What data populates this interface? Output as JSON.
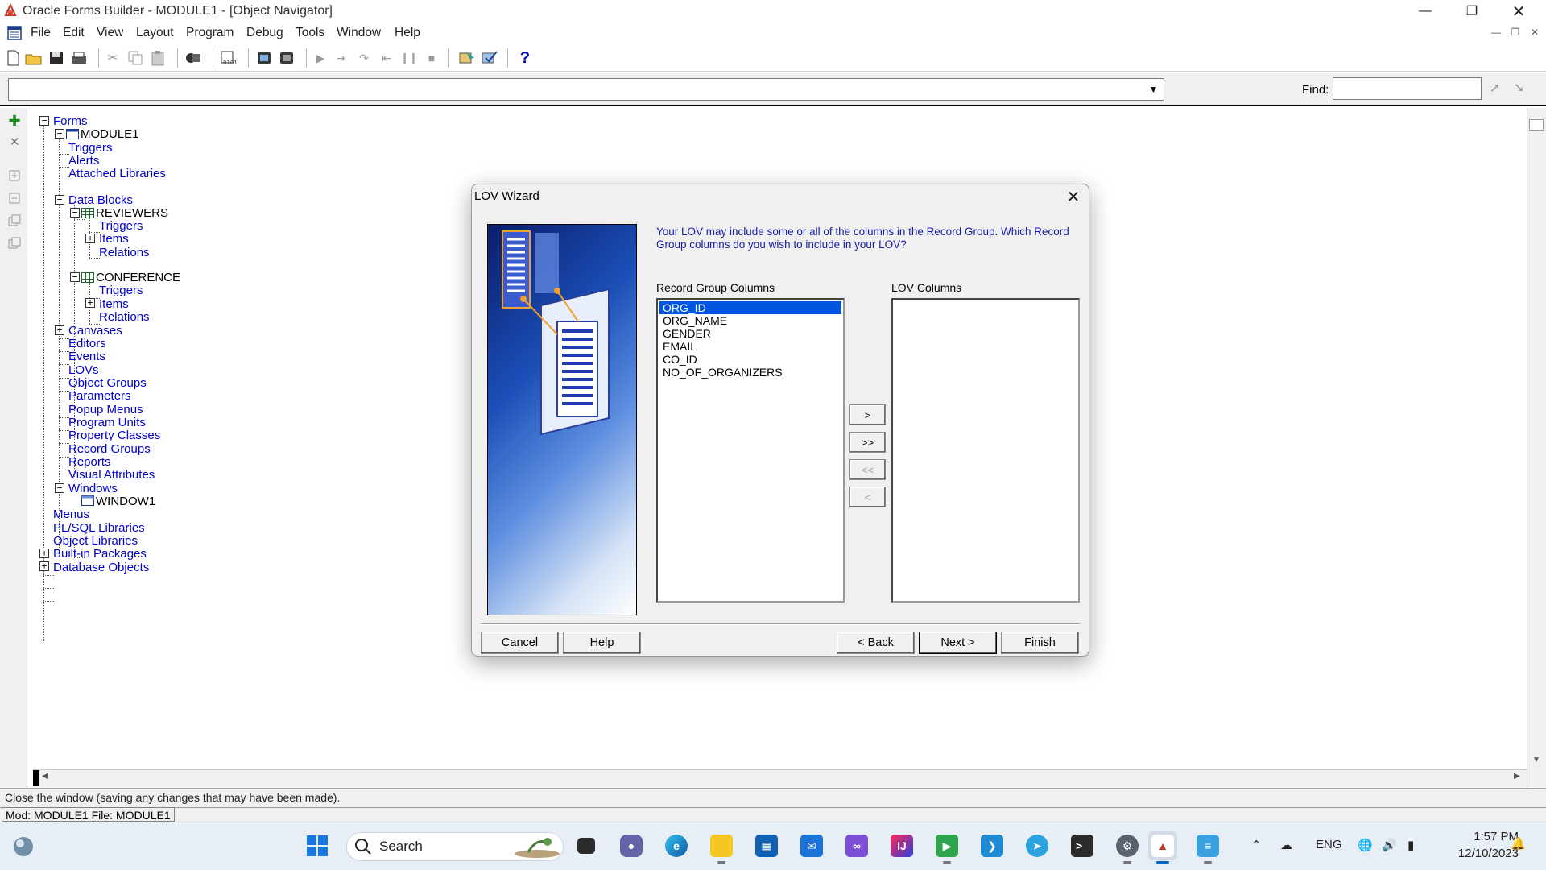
{
  "window": {
    "title": "Oracle Forms Builder - MODULE1 - [Object Navigator]",
    "minimize_icon": "minimize-icon",
    "restore_icon": "restore-icon",
    "close_icon": "close-icon"
  },
  "menu": {
    "items": [
      "File",
      "Edit",
      "View",
      "Layout",
      "Program",
      "Debug",
      "Tools",
      "Window",
      "Help"
    ]
  },
  "context_bar": {
    "combo_value": "",
    "find_label": "Find:",
    "find_value": ""
  },
  "navigator": {
    "nodes": [
      {
        "label": "Forms",
        "toggle": "minus"
      },
      {
        "label": "MODULE1",
        "toggle": "minus"
      },
      {
        "label": "Triggers"
      },
      {
        "label": "Alerts"
      },
      {
        "label": "Attached Libraries"
      },
      {
        "label": "Data Blocks",
        "toggle": "minus"
      },
      {
        "label": "REVIEWERS",
        "toggle": "minus"
      },
      {
        "label": "Triggers"
      },
      {
        "label": "Items",
        "toggle": "plus"
      },
      {
        "label": "Relations"
      },
      {
        "label": "CONFERENCE",
        "toggle": "minus"
      },
      {
        "label": "Triggers"
      },
      {
        "label": "Items",
        "toggle": "plus"
      },
      {
        "label": "Relations"
      },
      {
        "label": "Canvases",
        "toggle": "plus"
      },
      {
        "label": "Editors"
      },
      {
        "label": "Events"
      },
      {
        "label": "LOVs"
      },
      {
        "label": "Object Groups"
      },
      {
        "label": "Parameters"
      },
      {
        "label": "Popup Menus"
      },
      {
        "label": "Program Units"
      },
      {
        "label": "Property Classes"
      },
      {
        "label": "Record Groups"
      },
      {
        "label": "Reports"
      },
      {
        "label": "Visual Attributes"
      },
      {
        "label": "Windows",
        "toggle": "minus"
      },
      {
        "label": "WINDOW1"
      },
      {
        "label": "Menus"
      },
      {
        "label": "PL/SQL Libraries"
      },
      {
        "label": "Object Libraries"
      },
      {
        "label": "Built-in Packages",
        "toggle": "plus"
      },
      {
        "label": "Database Objects",
        "toggle": "plus"
      }
    ]
  },
  "dialog": {
    "title": "LOV Wizard",
    "instructions": "Your LOV may include some or all of the columns in the Record Group. Which Record Group columns do you wish to include in your LOV?",
    "record_group_label": "Record Group Columns",
    "lov_columns_label": "LOV Columns",
    "record_group_columns": [
      "ORG_ID",
      "ORG_NAME",
      "GENDER",
      "EMAIL",
      "CO_ID",
      "NO_OF_ORGANIZERS"
    ],
    "selected_index": 0,
    "lov_columns": [],
    "move_buttons": [
      ">",
      ">>",
      "<<",
      "<"
    ],
    "cancel": "Cancel",
    "help": "Help",
    "back": "< Back",
    "next": "Next >",
    "finish": "Finish"
  },
  "status": {
    "message": "Close the window (saving any changes that may have been made).",
    "module": "Mod: MODULE1 File: MODULE1"
  },
  "taskbar": {
    "search_placeholder": "Search",
    "language": "ENG",
    "time": "1:57 PM",
    "date": "12/10/2023"
  }
}
